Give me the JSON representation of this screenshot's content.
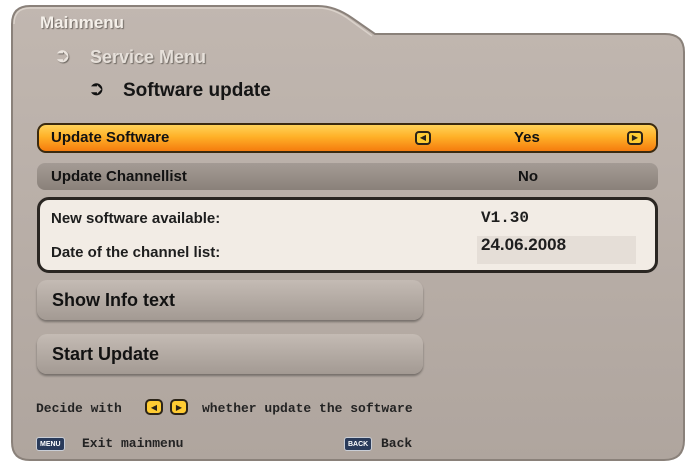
{
  "breadcrumb": {
    "level1": "Mainmenu",
    "level2": "Service Menu",
    "level3": "Software update"
  },
  "options": [
    {
      "label": "Update Software",
      "value": "Yes",
      "selected": true
    },
    {
      "label": "Update Channellist",
      "value": "No",
      "selected": false
    }
  ],
  "info": {
    "software_label": "New software available:",
    "software_value": "V1.30",
    "date_label": "Date of the channel list:",
    "date_value": "24.06.2008"
  },
  "buttons": {
    "show_info": "Show Info text",
    "start_update": "Start Update"
  },
  "hint": {
    "prefix": "Decide with",
    "suffix": "whether update the software"
  },
  "footer": {
    "menu_key": "MENU",
    "menu_label": "Exit mainmenu",
    "back_key": "BACK",
    "back_label": "Back"
  },
  "colors": {
    "panel": "#b8aea7",
    "selected_row": "#ffa51e",
    "key_yellow": "#ffcc33",
    "info_bg": "#f2ece5"
  },
  "icons": {
    "breadcrumb_arrow": "return-arrow-icon",
    "left_key": "left-arrow-key-icon",
    "right_key": "right-arrow-key-icon"
  }
}
